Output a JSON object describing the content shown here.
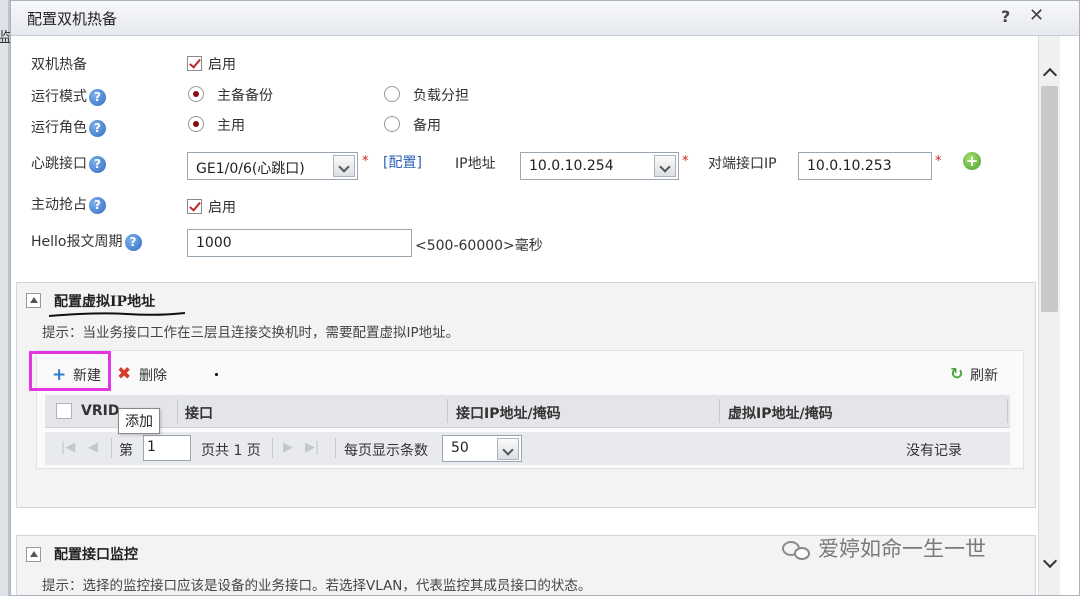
{
  "background": {
    "edge_glyph": "监"
  },
  "dialog": {
    "title": "配置双机热备",
    "help": "?",
    "close": "✕"
  },
  "form": {
    "hot_standby": {
      "label": "双机热备",
      "checked": true,
      "option": "启用"
    },
    "run_mode": {
      "label": "运行模式",
      "options": [
        "主备备份",
        "负载分担"
      ],
      "selected": "主备备份"
    },
    "run_role": {
      "label": "运行角色",
      "options": [
        "主用",
        "备用"
      ],
      "selected": "主用"
    },
    "heartbeat": {
      "label": "心跳接口",
      "interface_value": "GE1/0/6(心跳口)",
      "config_link": "[配置]",
      "ip_label": "IP地址",
      "ip_value": "10.0.10.254",
      "peer_label": "对端接口IP",
      "peer_value": "10.0.10.253",
      "required": "*"
    },
    "preempt": {
      "label": "主动抢占",
      "checked": true,
      "option": "启用"
    },
    "hello": {
      "label": "Hello报文周期",
      "value": "1000",
      "range": "<500-60000>毫秒"
    }
  },
  "virtual_ip_section": {
    "title": "配置虚拟IP地址",
    "hint": "提示：当业务接口工作在三层且连接交换机时，需要配置虚拟IP地址。",
    "toolbar": {
      "new": "新建",
      "delete": "删除",
      "refresh": "刷新"
    },
    "tooltip": "添加",
    "table": {
      "columns": [
        "VRID",
        "接口",
        "接口IP地址/掩码",
        "虚拟IP地址/掩码"
      ],
      "rows": []
    },
    "pager": {
      "page_prefix": "第",
      "page_value": "1",
      "page_suffix": "页共 1 页",
      "per_page_label": "每页显示条数",
      "per_page_value": "50",
      "empty": "没有记录"
    }
  },
  "monitor_section": {
    "title": "配置接口监控",
    "hint": "提示：选择的监控接口应该是设备的业务接口。若选择VLAN，代表监控其成员接口的状态。"
  },
  "watermark": "爱婷如命一生一世",
  "colors": {
    "accent_link": "#2d62b3",
    "required": "#d81e1e",
    "radio_selected": "#8b0d14",
    "highlight": "#e236e2"
  },
  "icons": [
    "help-icon",
    "close-icon",
    "question-icon",
    "checkbox-icon",
    "radio-icon",
    "dropdown-arrow-icon",
    "add-green-icon",
    "collapse-icon",
    "plus-icon",
    "delete-x-icon",
    "refresh-icon",
    "first-page-icon",
    "prev-page-icon",
    "next-page-icon",
    "last-page-icon",
    "wechat-icon",
    "scroll-up-icon",
    "scroll-down-icon"
  ]
}
